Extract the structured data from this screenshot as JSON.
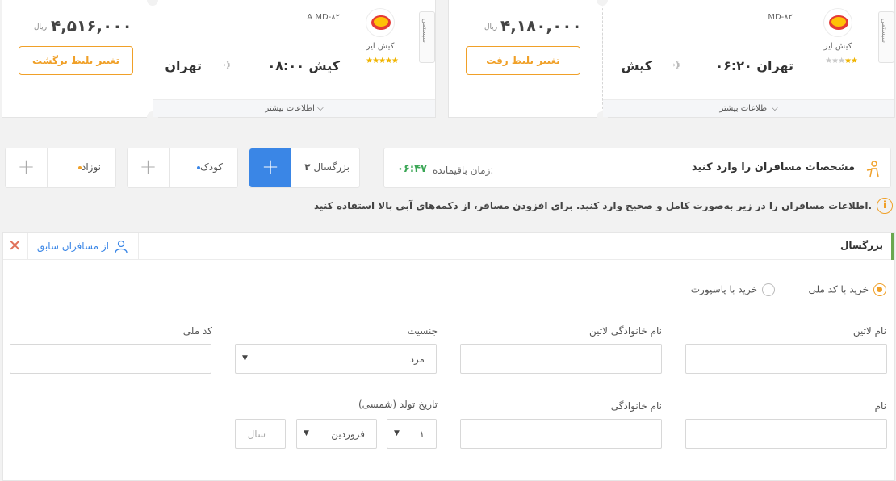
{
  "colors": {
    "accent": "#f0a028",
    "blue": "#3a86e6",
    "green": "#3aa655"
  },
  "cards": [
    {
      "side": "right",
      "system_label": "سیستمی",
      "airline": "کیش ایر",
      "stars_filled": "★★",
      "stars_empty": "★★★",
      "flight_no": "MD-۸۲",
      "origin_time": "تهران ۰۶:۲۰",
      "destination": "کیش",
      "more_info": "اطلاعات بیشتر",
      "price": "۴,۱۸۰,۰۰۰",
      "currency": "ریال",
      "change_label": "تغییر بلیط رفت"
    },
    {
      "side": "left",
      "system_label": "سیستمی",
      "airline": "کیش ایر",
      "stars_filled": "★★★★★",
      "stars_empty": "",
      "flight_no": "A MD-۸۲",
      "origin_time": "کیش ۰۸:۰۰",
      "destination": "تهران",
      "more_info": "اطلاعات بیشتر",
      "price": "۴,۵۱۶,۰۰۰",
      "currency": "ریال",
      "change_label": "تغییر بلیط برگشت"
    }
  ],
  "header": {
    "title": "مشخصات مسافران را وارد کنید",
    "timer_label": "زمان باقیمانده:",
    "timer_value": "۰۶:۴۷"
  },
  "counters": {
    "adult": {
      "label": "بزرگسال",
      "count": "۲"
    },
    "child": {
      "label": "کودک"
    },
    "infant": {
      "label": "نوزاد"
    },
    "plus": "+"
  },
  "notice": "اطلاعات مسافران را در زیر به‌صورت کامل و صحیح وارد کنید. برای افزودن مسافر، از دکمه‌های آبی بالا استفاده کنید.",
  "passenger": {
    "title": "بزرگسال",
    "previous_label": "از مسافران سابق",
    "radio_national": "خرید با کد ملی",
    "radio_passport": "خرید با پاسپورت",
    "latin_first_name": "نام لاتین",
    "latin_last_name": "نام خانوادگی لاتین",
    "gender": "جنسیت",
    "gender_value": "مرد",
    "national_code": "کد ملی",
    "first_name": "نام",
    "last_name": "نام خانوادگی",
    "birth_date": "تاریخ تولد (شمسی)",
    "day_value": "۱",
    "month_value": "فروردین",
    "year_placeholder": "سال"
  }
}
